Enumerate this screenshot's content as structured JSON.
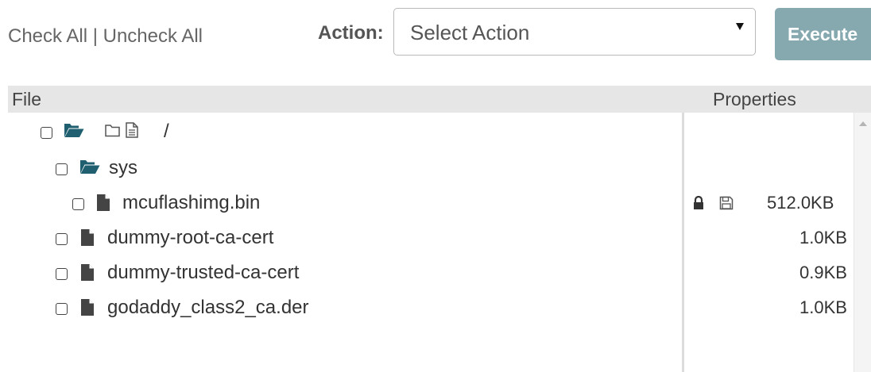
{
  "toolbar": {
    "check_all": "Check All",
    "separator": "|",
    "uncheck_all": "Uncheck All",
    "action_label": "Action:",
    "select_value": "Select Action",
    "execute_label": "Execute"
  },
  "table": {
    "col_file": "File",
    "col_properties": "Properties"
  },
  "tree": {
    "root": {
      "name": "/"
    },
    "sys": {
      "name": "sys"
    },
    "files": [
      {
        "name": "mcuflashimg.bin",
        "size": "512.0KB",
        "locked": true,
        "saved": true
      },
      {
        "name": "dummy-root-ca-cert",
        "size": "1.0KB"
      },
      {
        "name": "dummy-trusted-ca-cert",
        "size": "0.9KB"
      },
      {
        "name": "godaddy_class2_ca.der",
        "size": "1.0KB"
      }
    ]
  },
  "colors": {
    "accent_folder": "#1f5f70",
    "execute_bg": "#86a9b0",
    "header_bg": "#e6e6e6"
  }
}
